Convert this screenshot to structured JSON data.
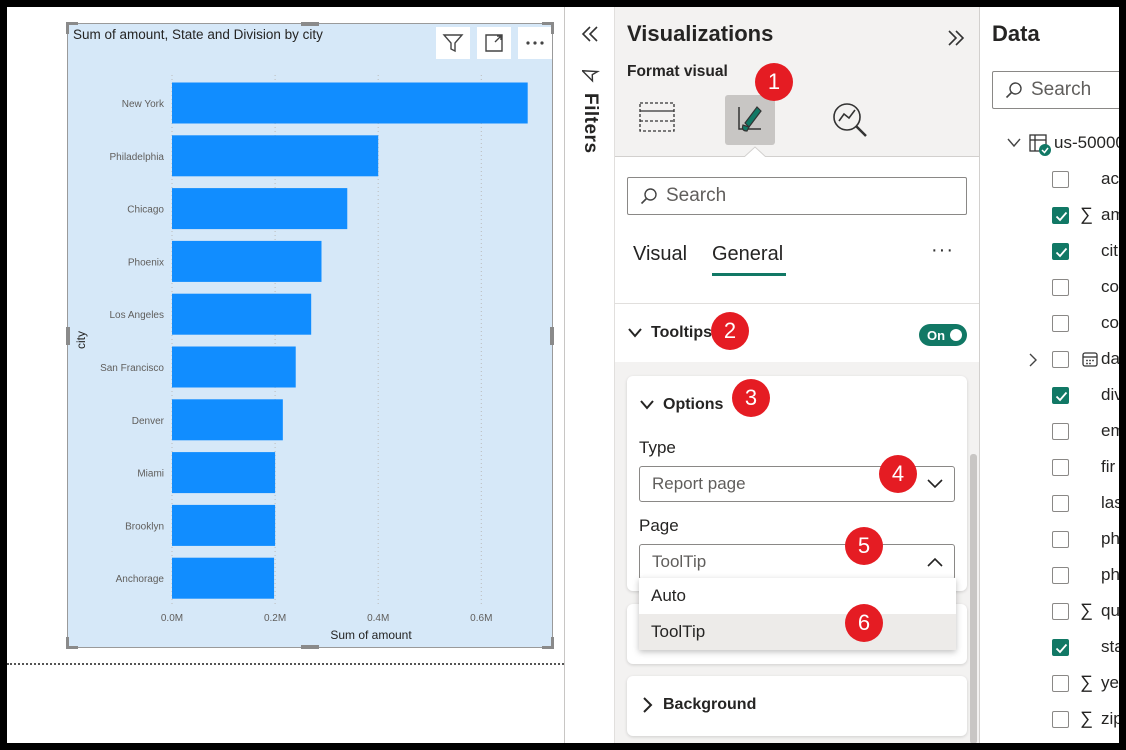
{
  "chart_data": {
    "type": "bar",
    "orientation": "horizontal",
    "title": "Sum of amount, State and Division by city",
    "xlabel": "Sum of amount",
    "ylabel": "city",
    "categories": [
      "New York",
      "Philadelphia",
      "Chicago",
      "Phoenix",
      "Los Angeles",
      "San Francisco",
      "Denver",
      "Miami",
      "Brooklyn",
      "Anchorage"
    ],
    "values": [
      0.69,
      0.4,
      0.34,
      0.29,
      0.27,
      0.24,
      0.215,
      0.2,
      0.2,
      0.198
    ],
    "x_ticks": [
      "0.0M",
      "0.2M",
      "0.4M",
      "0.6M"
    ],
    "xlim": [
      0,
      0.71
    ],
    "bar_color": "#118dff",
    "grid": true
  },
  "filters": {
    "label": "Filters",
    "icons": [
      "collapse-left-icon",
      "filter-icon"
    ]
  },
  "visualizations": {
    "title": "Visualizations",
    "format_visual_label": "Format visual",
    "search_placeholder": "Search",
    "tabs": [
      "Visual",
      "General"
    ],
    "active_tab": "General",
    "more_label": "···",
    "tooltips": {
      "label": "Tooltips",
      "toggle_label": "On",
      "options_label": "Options",
      "type_label": "Type",
      "type_value": "Report page",
      "page_label": "Page",
      "page_value": "ToolTip",
      "page_options": [
        "Auto",
        "ToolTip"
      ],
      "highlighted_option": "ToolTip"
    },
    "background_label": "Background",
    "accent_color": "#117865"
  },
  "data_pane": {
    "title": "Data",
    "search_placeholder": "Search",
    "table_name": "us-50000",
    "fields": [
      {
        "name": "ac",
        "checked": false,
        "sigma": false
      },
      {
        "name": "am",
        "checked": true,
        "sigma": true
      },
      {
        "name": "cit",
        "checked": true,
        "sigma": false
      },
      {
        "name": "co",
        "checked": false,
        "sigma": false
      },
      {
        "name": "co",
        "checked": false,
        "sigma": false
      },
      {
        "name": "da",
        "checked": false,
        "sigma": false,
        "calendar": true,
        "expand": true
      },
      {
        "name": "div",
        "checked": true,
        "sigma": false
      },
      {
        "name": "em",
        "checked": false,
        "sigma": false
      },
      {
        "name": "fir",
        "checked": false,
        "sigma": false
      },
      {
        "name": "las",
        "checked": false,
        "sigma": false
      },
      {
        "name": "ph",
        "checked": false,
        "sigma": false
      },
      {
        "name": "ph",
        "checked": false,
        "sigma": false
      },
      {
        "name": "qu",
        "checked": false,
        "sigma": true
      },
      {
        "name": "sta",
        "checked": true,
        "sigma": false
      },
      {
        "name": "ye",
        "checked": false,
        "sigma": true
      },
      {
        "name": "zip",
        "checked": false,
        "sigma": true
      }
    ]
  },
  "annotations": [
    "1",
    "2",
    "3",
    "4",
    "5",
    "6"
  ],
  "annotation_color": "#e51c23"
}
